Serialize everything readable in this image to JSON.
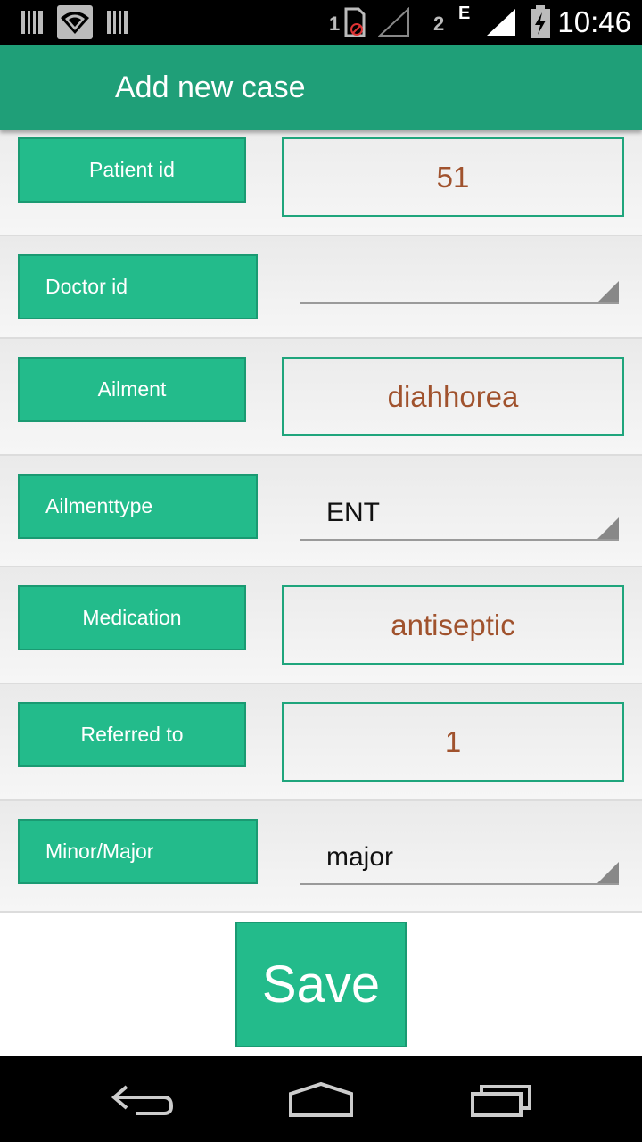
{
  "status_bar": {
    "time": "10:46",
    "sim1": "1",
    "sim2": "2",
    "network_type": "E",
    "icons": [
      "notification-icon",
      "wifi-icon",
      "notification-icon",
      "sim-card-icon",
      "signal-icon",
      "battery-charging-icon"
    ]
  },
  "app_bar": {
    "title": "Add new case"
  },
  "form": {
    "patient_id": {
      "label": "Patient id",
      "value": "51"
    },
    "doctor_id": {
      "label": "Doctor id",
      "value": ""
    },
    "ailment": {
      "label": "Ailment",
      "value": "diahhorea"
    },
    "ailment_type": {
      "label": "Ailmenttype",
      "value": "ENT"
    },
    "medication": {
      "label": "Medication",
      "value": "antiseptic"
    },
    "referred_to": {
      "label": "Referred to",
      "value": "1"
    },
    "severity": {
      "label": "Minor/Major",
      "value": "major"
    }
  },
  "actions": {
    "save_label": "Save"
  },
  "nav_bar": {
    "icons": [
      "back-icon",
      "home-icon",
      "recents-icon"
    ]
  },
  "colors": {
    "accent": "#23bb8b",
    "app_bar": "#1f9f78",
    "value_text": "#a0522d"
  }
}
